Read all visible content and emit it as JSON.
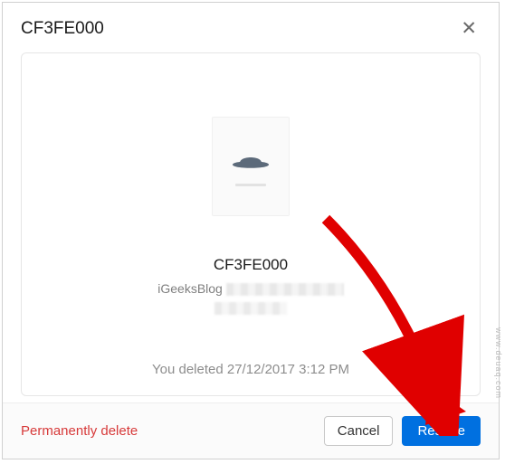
{
  "dialog": {
    "title": "CF3FE000"
  },
  "preview": {
    "file_name": "CF3FE000",
    "meta_prefix": "iGeeksBlog",
    "deleted_message": "You deleted 27/12/2017 3:12 PM"
  },
  "footer": {
    "permanently_delete": "Permanently delete",
    "cancel": "Cancel",
    "restore": "Restore"
  },
  "watermark": "www.deuaq.com",
  "colors": {
    "primary": "#0070e0",
    "danger": "#d73a3a"
  }
}
